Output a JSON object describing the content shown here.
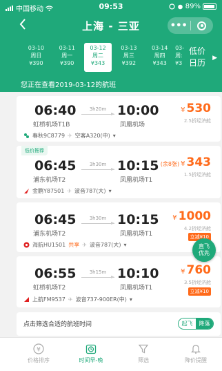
{
  "colors": {
    "brand": "#1fa97a",
    "price": "#ff6a1a"
  },
  "status": {
    "carrier": "中国移动",
    "time": "09:53",
    "battery": "89%"
  },
  "nav": {
    "title": "上海 - 三亚",
    "more": "•••"
  },
  "dates": [
    {
      "date": "03-10",
      "weekday": "周日",
      "price": "¥390"
    },
    {
      "date": "03-11",
      "weekday": "周一",
      "price": "¥390"
    },
    {
      "date": "03-12",
      "weekday": "周二",
      "price": "¥343"
    },
    {
      "date": "03-13",
      "weekday": "周三",
      "price": "¥392"
    },
    {
      "date": "03-14",
      "weekday": "周四",
      "price": "¥343"
    },
    {
      "date": "03-",
      "weekday": "周:",
      "price": "¥3"
    }
  ],
  "calendar": {
    "line1": "低价",
    "line2": "日历"
  },
  "banner": "您正在查看2019-03-12的航班",
  "flights": [
    {
      "dep_time": "06:40",
      "arr_time": "10:00",
      "duration": "3h20m",
      "dep_airport": "虹桥机场T1B",
      "arr_airport": "凤凰机场",
      "currency": "¥",
      "price": "530",
      "discount": "2.5折经济舱",
      "airline": "春秋9C8779",
      "plane": "空客A320(中)",
      "caret": "▾"
    },
    {
      "tag": "低价推荐",
      "dep_time": "06:45",
      "arr_time": "10:15",
      "duration": "3h30m",
      "dep_airport": "浦东机场T2",
      "arr_airport": "凤凰机场T1",
      "price_note": "(余8张)",
      "currency": "¥",
      "price": "343",
      "discount": "1.5折经济舱",
      "airline": "金鹏Y87501",
      "plane": "波音787(大)",
      "caret": "▾"
    },
    {
      "dep_time": "06:45",
      "arr_time": "10:15",
      "duration": "3h30m",
      "dep_airport": "浦东机场T2",
      "arr_airport": "凤凰机场T1",
      "currency": "¥",
      "price": "1000",
      "discount": "4.2折经济舱",
      "fare_tag": "立减¥10",
      "airline": "海航HU1501",
      "share": "共享",
      "plane": "波音787(大)",
      "caret": "▾"
    },
    {
      "dep_time": "06:55",
      "arr_time": "10:10",
      "duration": "3h15m",
      "dep_airport": "虹桥机场T2",
      "arr_airport": "凤凰机场T1",
      "currency": "¥",
      "price": "760",
      "discount": "3.5折经济舱",
      "fare_tag": "立减¥10",
      "airline": "上航FM9537",
      "plane": "波音737-900ER(中)",
      "caret": "▾"
    }
  ],
  "fab": {
    "line1": "直飞",
    "line2": "优先"
  },
  "filter": {
    "text": "点击筛选合适的航班时间",
    "opt_on": "起飞",
    "opt_off": "降落"
  },
  "tabs": [
    {
      "label": "价格排序",
      "icon": "yen-circle-icon"
    },
    {
      "label": "时间早-晚",
      "icon": "clock-icon"
    },
    {
      "label": "筛选",
      "icon": "filter-icon"
    },
    {
      "label": "降价提醒",
      "icon": "bell-icon"
    }
  ]
}
